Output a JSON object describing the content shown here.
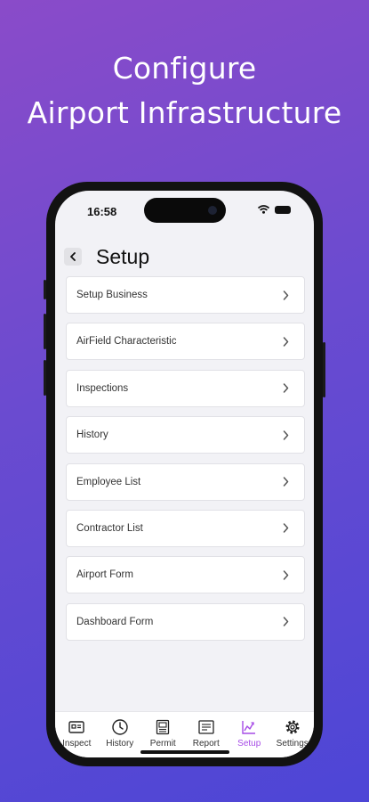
{
  "headline": {
    "line1": "Configure",
    "line2": "Airport Infrastructure"
  },
  "status_bar": {
    "time": "16:58"
  },
  "nav": {
    "title": "Setup"
  },
  "menu": {
    "items": [
      {
        "label": "Setup Business"
      },
      {
        "label": "AirField Characteristic"
      },
      {
        "label": "Inspections"
      },
      {
        "label": "History"
      },
      {
        "label": "Employee List"
      },
      {
        "label": "Contractor List"
      },
      {
        "label": "Airport Form"
      },
      {
        "label": "Dashboard Form"
      }
    ]
  },
  "tab_bar": {
    "active": "Setup",
    "tabs": [
      {
        "label": "Inspect",
        "icon": "inspect-icon"
      },
      {
        "label": "History",
        "icon": "clock-icon"
      },
      {
        "label": "Permit",
        "icon": "permit-icon"
      },
      {
        "label": "Report",
        "icon": "report-icon"
      },
      {
        "label": "Setup",
        "icon": "setup-icon"
      },
      {
        "label": "Settings",
        "icon": "gear-icon"
      }
    ]
  },
  "colors": {
    "accent": "#a64be6",
    "background_start": "#8a4bc9",
    "background_end": "#4d46d6"
  }
}
